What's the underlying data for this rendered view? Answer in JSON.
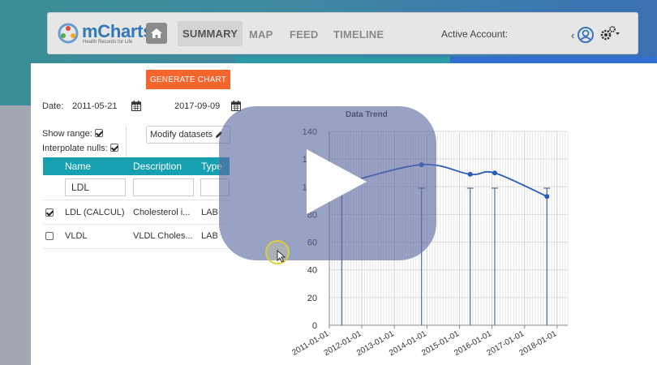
{
  "header": {
    "brand": "mCharts",
    "brand_sub": "Health Records for Life",
    "nav": [
      "SUMMARY",
      "MAP",
      "FEED",
      "TIMELINE"
    ],
    "active_account_label": "Active Account:"
  },
  "controls": {
    "generate_label": "GENERATE CHART",
    "date_label": "Date:",
    "start_date": "2011-05-21",
    "end_date": "2017-09-09",
    "show_range_label": "Show range:",
    "interpolate_label": "Interpolate nulls:",
    "modify_label": "Modify datasets"
  },
  "table": {
    "columns": [
      "Name",
      "Description",
      "Type"
    ],
    "filter_name": "LDL",
    "rows": [
      {
        "name": "LDL (CALCUL)",
        "description": "Cholesterol i...",
        "type": "LAB",
        "checked": true
      },
      {
        "name": "VLDL",
        "description": "VLDL Choles...",
        "type": "LAB",
        "checked": false
      }
    ]
  },
  "chart_data": {
    "type": "line",
    "title": "Data Trend",
    "x_ticks": [
      "2011-01-01",
      "2012-01-01",
      "2013-01-01",
      "2014-01-01",
      "2015-01-01",
      "2016-01-01",
      "2017-01-01",
      "2018-01-01"
    ],
    "series": [
      {
        "x": [
          "2011-05-21",
          "2013-11-01",
          "2015-05-01",
          "2016-02-01",
          "2017-09-09"
        ],
        "values": [
          102,
          116,
          109,
          110,
          93
        ]
      }
    ],
    "range_lines": [
      {
        "x": "2011-05-21",
        "low": 0,
        "high": 99
      },
      {
        "x": "2013-11-01",
        "low": 0,
        "high": 99
      },
      {
        "x": "2015-05-01",
        "low": 0,
        "high": 99
      },
      {
        "x": "2016-02-01",
        "low": 0,
        "high": 99
      },
      {
        "x": "2017-09-09",
        "low": 0,
        "high": 99
      }
    ],
    "y_ticks": [
      0,
      20,
      40,
      60,
      80,
      100,
      120,
      140
    ],
    "ylim": [
      0,
      140
    ],
    "xlim": [
      "2011-01-01",
      "2018-05-01"
    ],
    "grid": true,
    "line_color": "#2a5bb8"
  }
}
